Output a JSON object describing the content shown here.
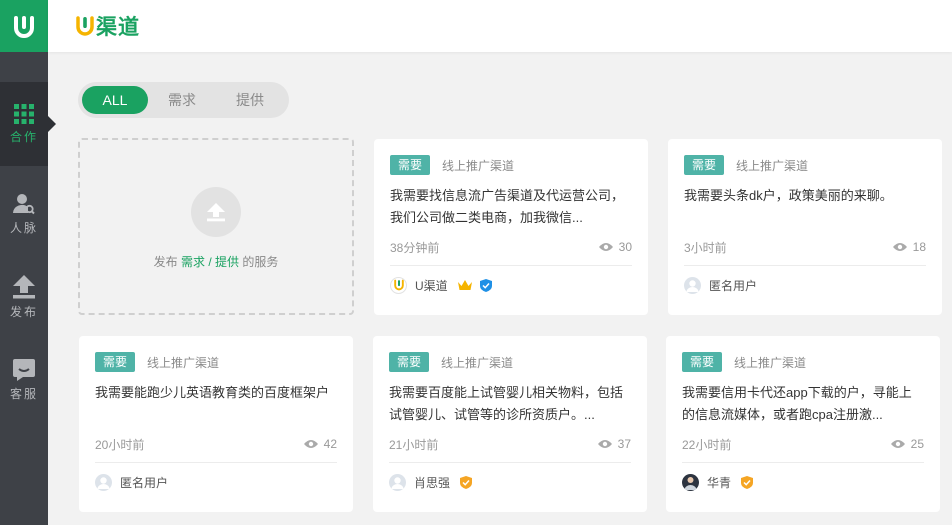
{
  "app": {
    "brand": "渠道",
    "logo_letter": "U"
  },
  "sidebar": {
    "items": [
      {
        "label": "合作",
        "icon": "grid-icon",
        "active": true
      },
      {
        "label": "人脉",
        "icon": "user-search-icon"
      },
      {
        "label": "发布",
        "icon": "upload-icon"
      },
      {
        "label": "客服",
        "icon": "chat-icon"
      }
    ]
  },
  "tabs": [
    "ALL",
    "需求",
    "提供"
  ],
  "publish": {
    "prefix": "发布",
    "need": "需求",
    "slash": "/",
    "offer": "提供",
    "suffix": "的服务"
  },
  "cards": [
    {
      "badge": "需要",
      "channel": "线上推广渠道",
      "title": "我需要找信息流广告渠道及代运营公司，我们公司做二类电商，加我微信...",
      "time": "38分钟前",
      "views": "30",
      "user": "U渠道",
      "avatar": "u-logo",
      "crown": true,
      "verified": "blue"
    },
    {
      "badge": "需要",
      "channel": "线上推广渠道",
      "title": "我需要头条dk户，政策美丽的来聊。",
      "time": "3小时前",
      "views": "18",
      "user": "匿名用户",
      "avatar": "anon"
    },
    {
      "badge": "需要",
      "channel": "线上推广渠道",
      "title": "我需要能跑少儿英语教育类的百度框架户",
      "time": "20小时前",
      "views": "42",
      "user": "匿名用户",
      "avatar": "anon"
    },
    {
      "badge": "需要",
      "channel": "线上推广渠道",
      "title": "我需要百度能上试管婴儿相关物料，包括试管婴儿、试管等的诊所资质户。...",
      "time": "21小时前",
      "views": "37",
      "user": "肖思强",
      "avatar": "anon",
      "verified": "orange"
    },
    {
      "badge": "需要",
      "channel": "线上推广渠道",
      "title": "我需要信用卡代还app下载的户，寻能上的信息流媒体，或者跑cpa注册激...",
      "time": "22小时前",
      "views": "25",
      "user": "华青",
      "avatar": "photo",
      "verified": "orange"
    }
  ],
  "colors": {
    "brand": "#1aa261",
    "badge": "#4fb3a7",
    "sidebar": "#3e4147",
    "crown": "#f5b400",
    "verified_blue": "#1e90e6",
    "verified_orange": "#f5a524"
  }
}
